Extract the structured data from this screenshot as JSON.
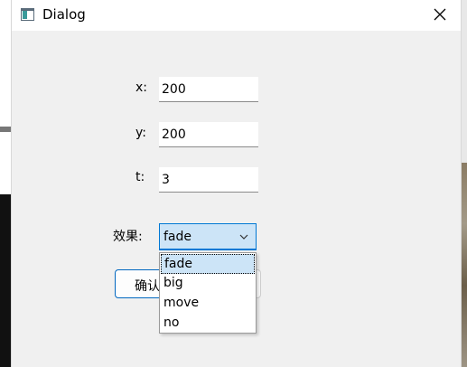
{
  "window": {
    "title": "Dialog"
  },
  "form": {
    "x": {
      "label": "x:",
      "value": "200"
    },
    "y": {
      "label": "y:",
      "value": "200"
    },
    "t": {
      "label": "t:",
      "value": "3"
    },
    "effect": {
      "label": "效果:",
      "selected": "fade",
      "options": [
        "fade",
        "big",
        "move",
        "no"
      ],
      "highlighted_index": 0
    }
  },
  "buttons": {
    "ok_label": "确认"
  },
  "colors": {
    "accent": "#0078d4",
    "selection": "#cce4f7"
  }
}
